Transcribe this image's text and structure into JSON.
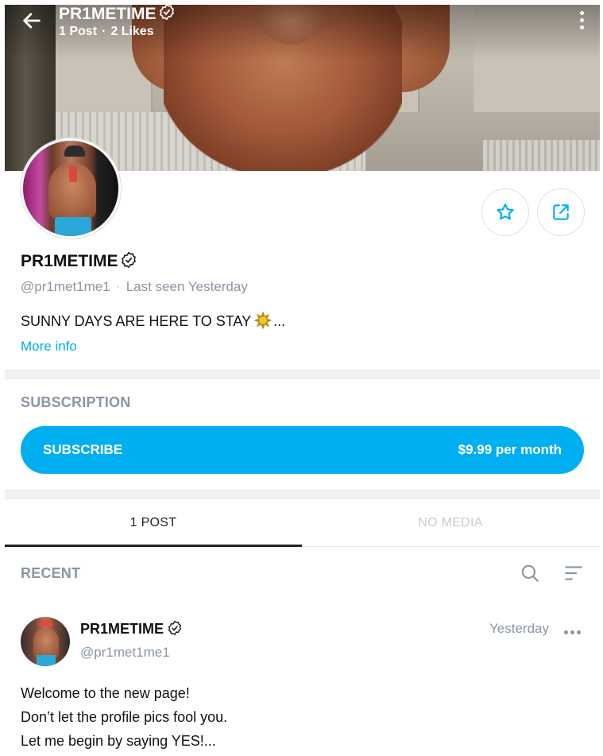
{
  "header": {
    "title": "PR1METIME",
    "posts": "1 Post",
    "likes": "2 Likes",
    "separator": "·"
  },
  "profile": {
    "name": "PR1METIME",
    "handle": "@pr1met1me1",
    "separator": "·",
    "last_seen": "Last seen Yesterday",
    "bio": "SUNNY DAYS ARE HERE TO STAY",
    "bio_ellipsis": "...",
    "more_info": "More info"
  },
  "subscription": {
    "label": "SUBSCRIPTION",
    "button_label": "SUBSCRIBE",
    "price": "$9.99 per month"
  },
  "tabs": [
    {
      "label": "1 POST",
      "active": true
    },
    {
      "label": "NO MEDIA",
      "active": false
    }
  ],
  "feed": {
    "label": "RECENT"
  },
  "post": {
    "name": "PR1METIME",
    "handle": "@pr1met1me1",
    "time": "Yesterday",
    "lines": [
      "Welcome to the new page!",
      "Don’t let the profile pics fool you.",
      "Let me begin by saying YES!..."
    ]
  },
  "colors": {
    "accent": "#00aff0",
    "muted": "#8a96a3"
  },
  "icons": [
    "back-arrow-icon",
    "verified-icon",
    "kebab-icon",
    "star-icon",
    "share-icon",
    "sun-emoji-icon",
    "search-icon",
    "sort-icon",
    "more-dots-icon"
  ]
}
